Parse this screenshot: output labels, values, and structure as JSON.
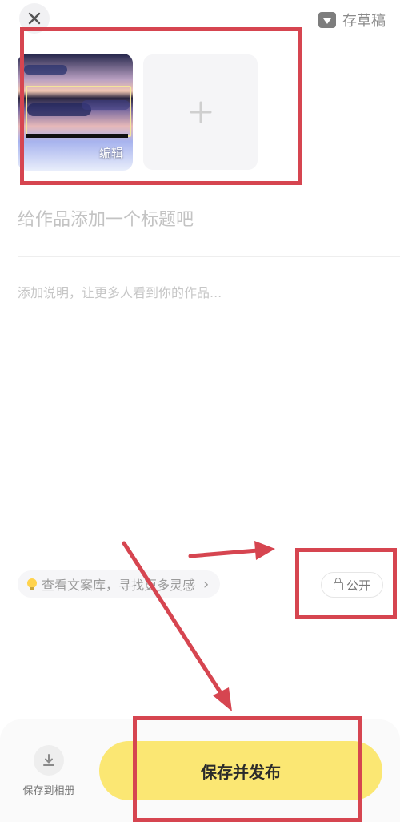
{
  "header": {
    "close_icon": "close-icon",
    "draft_label": "存草稿",
    "draft_icon": "draft-box-icon"
  },
  "media": {
    "edit_label": "编辑",
    "add_icon": "plus-icon"
  },
  "form": {
    "title_placeholder": "给作品添加一个标题吧",
    "description_placeholder": "添加说明，让更多人看到你的作品..."
  },
  "inspiration": {
    "label": "查看文案库，寻找更多灵感",
    "icon": "lightbulb-icon",
    "chevron_icon": "chevron-right-icon"
  },
  "visibility": {
    "label": "公开",
    "icon": "lock-open-icon"
  },
  "bottom": {
    "save_album_label": "保存到相册",
    "save_album_icon": "download-icon",
    "publish_label": "保存并发布"
  },
  "colors": {
    "annotation": "#d64550",
    "publish_button": "#fbe773"
  }
}
